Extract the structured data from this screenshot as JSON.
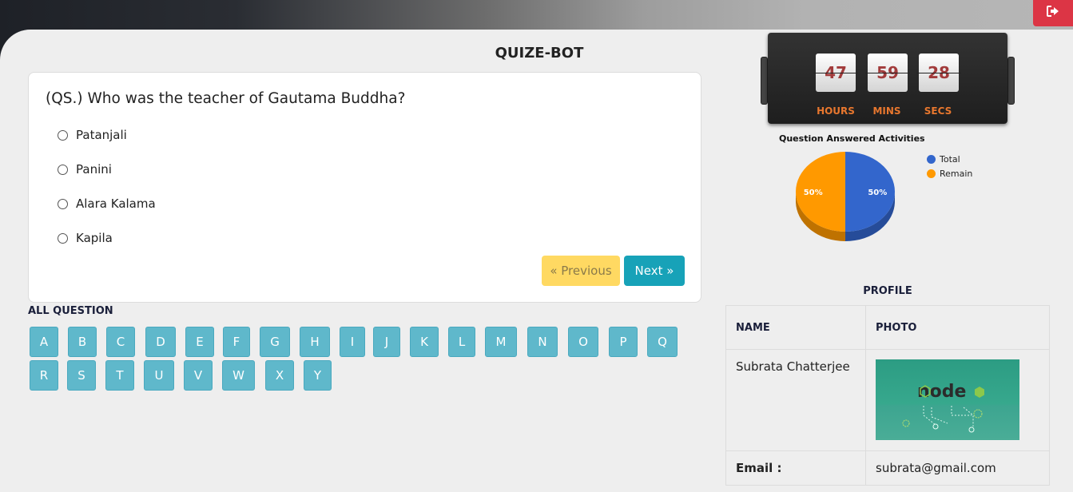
{
  "app": {
    "title": "QUIZE-BOT"
  },
  "question": {
    "text": "(QS.) Who was the teacher of Gautama Buddha?",
    "options": [
      "Patanjali",
      "Panini",
      "Alara Kalama",
      "Kapila"
    ]
  },
  "nav": {
    "previous_label": "« Previous",
    "next_label": "Next »"
  },
  "all_questions": {
    "label": "ALL QUESTION",
    "letters": [
      "A",
      "B",
      "C",
      "D",
      "E",
      "F",
      "G",
      "H",
      "I",
      "J",
      "K",
      "L",
      "M",
      "N",
      "O",
      "P",
      "Q",
      "R",
      "S",
      "T",
      "U",
      "V",
      "W",
      "X",
      "Y"
    ]
  },
  "timer": {
    "hours": "47",
    "mins": "59",
    "secs": "28",
    "hours_label": "HOURS",
    "mins_label": "MINS",
    "secs_label": "SECS"
  },
  "chart_data": {
    "type": "pie",
    "title": "Question Answered Activities",
    "labels": [
      "Total",
      "Remain"
    ],
    "values": [
      50,
      50
    ],
    "value_labels": [
      "50%",
      "50%"
    ],
    "colors": [
      "#3366cc",
      "#ff9900"
    ],
    "legend": "right"
  },
  "profile": {
    "title": "PROFILE",
    "name_header": "NAME",
    "photo_header": "PHOTO",
    "name": "Subrata Chatterjee",
    "email_label": "Email :",
    "email": "subrata@gmail.com",
    "photo_logo_text": "node"
  },
  "colors": {
    "logout": "#dc3545",
    "next": "#17a2b8",
    "previous": "#ffd962",
    "letter_button": "#5fb8cb",
    "timer_label": "#e8772e",
    "timer_digit": "#a23b3b"
  }
}
